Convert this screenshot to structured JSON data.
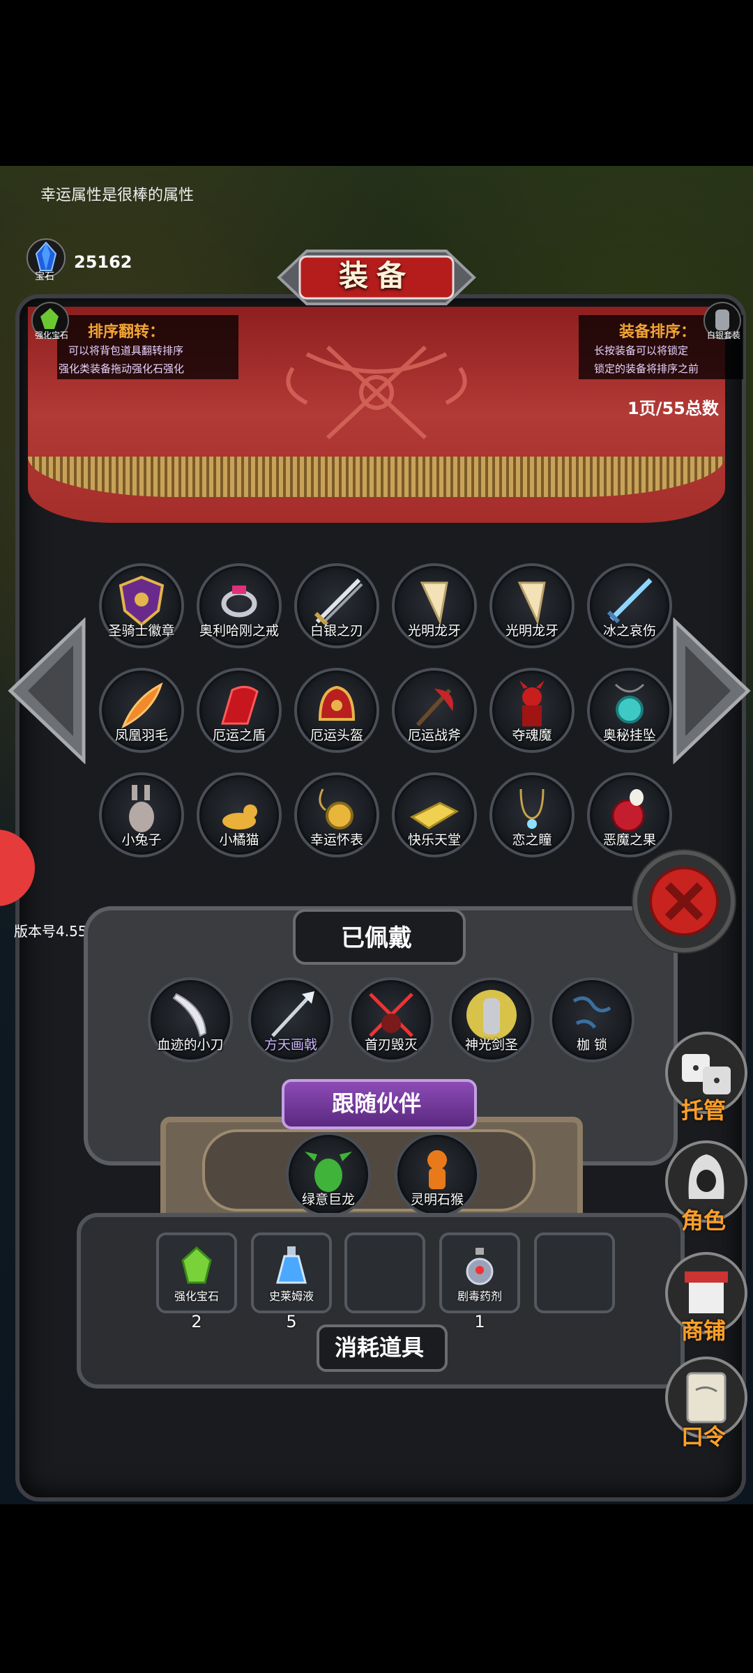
{
  "tip": "幸运属性是很棒的属性",
  "gems": {
    "count": "25162",
    "label": "宝石"
  },
  "header": {
    "title": "装备",
    "enhance_gem_label": "强化宝石",
    "armor_label": "白银套装",
    "sort_flip": {
      "title": "排序翻转：",
      "lines": [
        "可以将背包道具翻转排序",
        "强化类装备拖动强化石强化"
      ]
    },
    "equip_sort": {
      "title": "装备排序：",
      "lines": [
        "长按装备可以将锁定",
        "锁定的装备将排序之前"
      ]
    },
    "page_info": "1页/55总数"
  },
  "items": [
    {
      "label": "圣骑士徽章",
      "icon": "shield-badge-icon"
    },
    {
      "label": "奥利哈刚之戒",
      "icon": "ring-icon"
    },
    {
      "label": "白银之刃",
      "icon": "sword-icon"
    },
    {
      "label": "光明龙牙",
      "icon": "fang-icon"
    },
    {
      "label": "光明龙牙",
      "icon": "fang-icon"
    },
    {
      "label": "冰之哀伤",
      "icon": "ice-sword-icon"
    },
    {
      "label": "凤凰羽毛",
      "icon": "feather-icon"
    },
    {
      "label": "厄运之盾",
      "icon": "red-shield-icon"
    },
    {
      "label": "厄运头盔",
      "icon": "helmet-icon"
    },
    {
      "label": "厄运战斧",
      "icon": "axe-icon"
    },
    {
      "label": "夺魂魔",
      "icon": "demon-icon"
    },
    {
      "label": "奥秘挂坠",
      "icon": "pendant-icon"
    },
    {
      "label": "小兔子",
      "icon": "rabbit-icon"
    },
    {
      "label": "小橘猫",
      "icon": "cat-icon"
    },
    {
      "label": "幸运怀表",
      "icon": "pocket-watch-icon"
    },
    {
      "label": "快乐天堂",
      "icon": "book-icon"
    },
    {
      "label": "恋之瞳",
      "icon": "necklace-icon"
    },
    {
      "label": "恶魔之果",
      "icon": "fruit-icon"
    }
  ],
  "equipped": {
    "title": "已佩戴",
    "items": [
      {
        "label": "血迹的小刀",
        "icon": "knife-icon"
      },
      {
        "label": "方天画戟",
        "icon": "halberd-icon"
      },
      {
        "label": "首刃毁灭",
        "icon": "blades-icon"
      },
      {
        "label": "神光剑圣",
        "icon": "knight-icon"
      },
      {
        "label": "枷 锁",
        "icon": "chain-icon"
      }
    ]
  },
  "companions": {
    "title": "跟随伙伴",
    "items": [
      {
        "label": "绿意巨龙",
        "icon": "green-dragon-icon"
      },
      {
        "label": "灵明石猴",
        "icon": "monkey-icon"
      }
    ]
  },
  "consumables": {
    "title": "消耗道具",
    "items": [
      {
        "label": "强化宝石",
        "count": "2",
        "icon": "green-gem-icon"
      },
      {
        "label": "史莱姆液",
        "count": "5",
        "icon": "potion-icon"
      },
      {
        "label": "",
        "count": "",
        "icon": ""
      },
      {
        "label": "剧毒药剂",
        "count": "1",
        "icon": "poison-icon"
      },
      {
        "label": "",
        "count": "",
        "icon": ""
      }
    ]
  },
  "side_menu": [
    {
      "label": "托管",
      "icon": "dice-icon"
    },
    {
      "label": "角色",
      "icon": "hooded-figure-icon"
    },
    {
      "label": "商铺",
      "icon": "shop-icon"
    },
    {
      "label": "口令",
      "icon": "scroll-icon"
    }
  ],
  "version": "版本号4.55",
  "colors": {
    "accent": "#f2a534",
    "banner": "#b23a36",
    "side_label": "#ff9f28"
  }
}
